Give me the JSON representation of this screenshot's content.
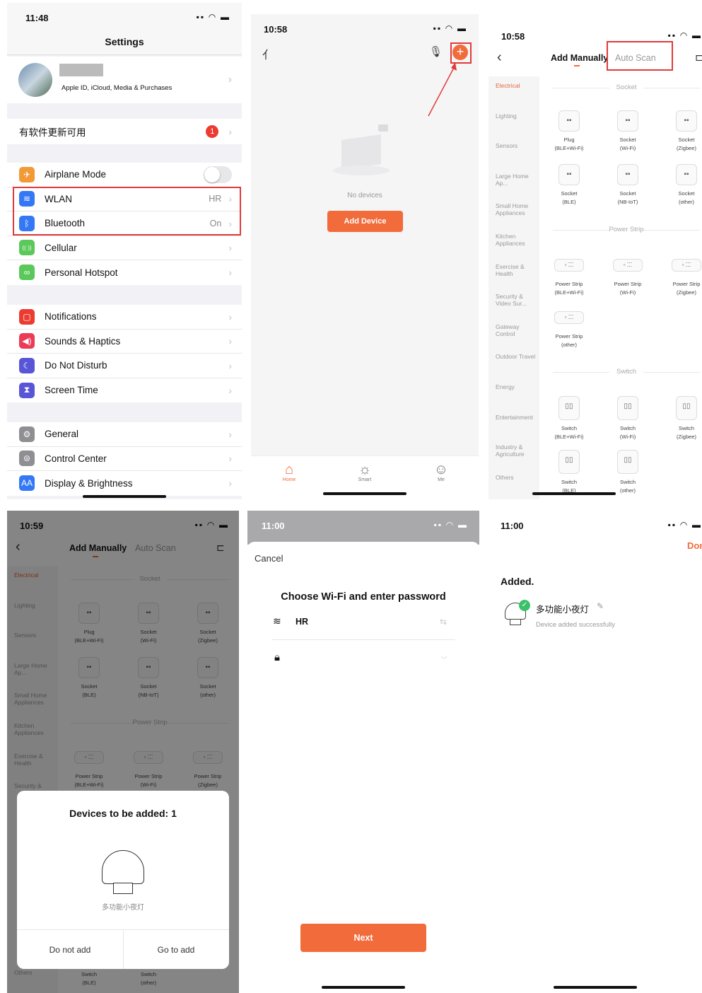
{
  "panel1": {
    "time": "11:48",
    "title": "Settings",
    "account_subtitle": "Apple ID, iCloud, Media & Purchases",
    "update_row": {
      "label": "有软件更新可用",
      "badge": "1"
    },
    "group1": [
      {
        "label": "Airplane Mode",
        "icon": "airplane-icon",
        "color": "#f19a37",
        "glyph": "✈",
        "toggle": true
      },
      {
        "label": "WLAN",
        "icon": "wifi-icon",
        "color": "#3478f6",
        "glyph": "≋",
        "value": "HR"
      },
      {
        "label": "Bluetooth",
        "icon": "bluetooth-icon",
        "color": "#3478f6",
        "glyph": "ᛒ",
        "value": "On"
      },
      {
        "label": "Cellular",
        "icon": "cellular-icon",
        "color": "#5ac85a",
        "glyph": "((·))"
      },
      {
        "label": "Personal Hotspot",
        "icon": "hotspot-icon",
        "color": "#5ac85a",
        "glyph": "∞"
      }
    ],
    "group2": [
      {
        "label": "Notifications",
        "icon": "notifications-icon",
        "color": "#ec3b30",
        "glyph": "▢"
      },
      {
        "label": "Sounds & Haptics",
        "icon": "sound-icon",
        "color": "#ec3b56",
        "glyph": "◀)"
      },
      {
        "label": "Do Not Disturb",
        "icon": "moon-icon",
        "color": "#5856d6",
        "glyph": "☾"
      },
      {
        "label": "Screen Time",
        "icon": "hourglass-icon",
        "color": "#5856d6",
        "glyph": "⧗"
      }
    ],
    "group3": [
      {
        "label": "General",
        "icon": "gear-icon",
        "color": "#8e8e93",
        "glyph": "⚙"
      },
      {
        "label": "Control Center",
        "icon": "control-center-icon",
        "color": "#8e8e93",
        "glyph": "⊜"
      },
      {
        "label": "Display & Brightness",
        "icon": "display-icon",
        "color": "#3478f6",
        "glyph": "AA"
      }
    ]
  },
  "panel2": {
    "time": "10:58",
    "no_devices": "No devices",
    "add_device": "Add Device",
    "tabs": [
      {
        "label": "Home",
        "icon": "home-icon",
        "glyph": "⌂",
        "active": true
      },
      {
        "label": "Smart",
        "icon": "sun-icon",
        "glyph": "☼",
        "active": false
      },
      {
        "label": "Me",
        "icon": "person-icon",
        "glyph": "☺",
        "active": false
      }
    ],
    "accent": "#f26b3a"
  },
  "panel3": {
    "time": "10:58",
    "tab_manual": "Add Manually",
    "tab_auto": "Auto Scan",
    "categories": [
      "Electrical",
      "Lighting",
      "Sensors",
      "Large Home Ap...",
      "Small Home Appliances",
      "Kitchen Appliances",
      "Exercise & Health",
      "Security & Video Sur...",
      "Gateway Control",
      "Outdoor Travel",
      "Energy",
      "Entertainment",
      "Industry & Agriculture",
      "Others"
    ],
    "section_socket": "Socket",
    "sockets": [
      {
        "name": "Plug",
        "sub": "(BLE+Wi-Fi)"
      },
      {
        "name": "Socket",
        "sub": "(Wi-Fi)"
      },
      {
        "name": "Socket",
        "sub": "(Zigbee)"
      },
      {
        "name": "Socket",
        "sub": "(BLE)"
      },
      {
        "name": "Socket",
        "sub": "(NB-IoT)"
      },
      {
        "name": "Socket",
        "sub": "(other)"
      }
    ],
    "section_strip": "Power Strip",
    "strips": [
      {
        "name": "Power Strip",
        "sub": "(BLE+Wi-Fi)"
      },
      {
        "name": "Power Strip",
        "sub": "(Wi-Fi)"
      },
      {
        "name": "Power Strip",
        "sub": "(Zigbee)"
      },
      {
        "name": "Power Strip",
        "sub": "(other)"
      }
    ],
    "section_switch": "Switch",
    "switches": [
      {
        "name": "Switch",
        "sub": "(BLE+Wi-Fi)"
      },
      {
        "name": "Switch",
        "sub": "(Wi-Fi)"
      },
      {
        "name": "Switch",
        "sub": "(Zigbee)"
      },
      {
        "name": "Switch",
        "sub": "(BLE)"
      },
      {
        "name": "Switch",
        "sub": "(other)"
      }
    ]
  },
  "panel4": {
    "time": "10:59",
    "dialog_title": "Devices to be added: 1",
    "device_name": "多功能小夜灯",
    "do_not_add": "Do not add",
    "go_to_add": "Go to add",
    "categories": [
      "Electrical",
      "Lighting",
      "Sensors",
      "Large Home Ap...",
      "Small Home Appliances",
      "Kitchen Appliances",
      "Exercise & Health",
      "Security &",
      "Others"
    ],
    "strips": [
      {
        "name": "Power Strip",
        "sub": "(BLE+Wi-Fi)"
      },
      {
        "name": "Power Strip",
        "sub": "(Wi-Fi)"
      },
      {
        "name": "Power Strip",
        "sub": "(Zigbee)"
      }
    ],
    "bottom_switches": [
      {
        "name": "Switch",
        "sub": "(BLE)"
      },
      {
        "name": "Switch",
        "sub": "(other)"
      }
    ]
  },
  "panel5": {
    "time": "11:00",
    "cancel": "Cancel",
    "heading": "Choose Wi-Fi and enter password",
    "ssid": "HR",
    "next": "Next"
  },
  "panel6": {
    "time": "11:00",
    "done": "Done",
    "added": "Added.",
    "device_name": "多功能小夜灯",
    "success": "Device added successfully"
  }
}
